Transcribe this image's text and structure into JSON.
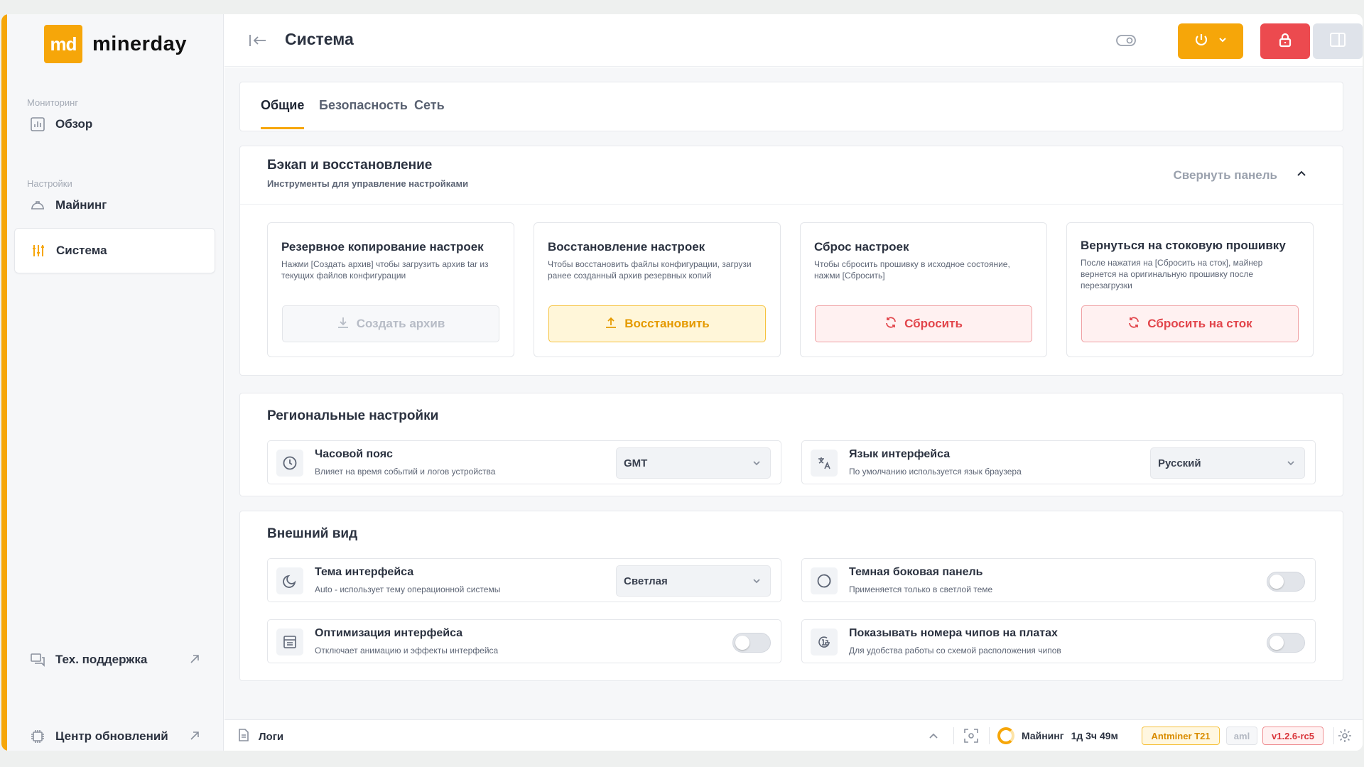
{
  "brand": {
    "mark": "md",
    "name": "minerday"
  },
  "sidebar": {
    "section_monitoring": "Мониторинг",
    "overview": "Обзор",
    "section_settings": "Настройки",
    "mining": "Майнинг",
    "system": "Система",
    "support": "Тех. поддержка",
    "updates": "Центр обновлений"
  },
  "header": {
    "title": "Система"
  },
  "tabs": [
    {
      "label": "Общие",
      "active": true
    },
    {
      "label": "Безопасность",
      "active": false
    },
    {
      "label": "Сеть",
      "active": false
    }
  ],
  "backup": {
    "title": "Бэкап и восстановление",
    "subtitle": "Инструменты для управление настройками",
    "collapse_label": "Свернуть панель",
    "cards": [
      {
        "title": "Резервное копирование настроек",
        "desc": "Нажми [Создать архив] чтобы загрузить архив tar из текущих файлов конфигурации",
        "button": "Создать архив",
        "state": "disabled"
      },
      {
        "title": "Восстановление настроек",
        "desc": "Чтобы восстановить файлы конфигурации, загрузи ранее созданный архив резервных копий",
        "button": "Восстановить",
        "state": "warning"
      },
      {
        "title": "Сброс настроек",
        "desc": "Чтобы сбросить прошивку в исходное состояние, нажми [Сбросить]",
        "button": "Сбросить",
        "state": "danger"
      },
      {
        "title": "Вернуться на стоковую прошивку",
        "desc": "После нажатия на [Сбросить на сток], майнер вернется на оригинальную прошивку после перезагрузки",
        "button": "Сбросить на сток",
        "state": "danger"
      }
    ]
  },
  "regional": {
    "title": "Региональные настройки",
    "timezone": {
      "title": "Часовой пояс",
      "desc": "Влияет на время событий и логов устройства",
      "value": "GMT"
    },
    "language": {
      "title": "Язык интерфейса",
      "desc": "По умолчанию используется язык браузера",
      "value": "Русский"
    }
  },
  "appearance": {
    "title": "Внешний вид",
    "theme": {
      "title": "Тема интерфейса",
      "desc": "Auto - использует тему операционной системы",
      "value": "Светлая"
    },
    "dark_sidebar": {
      "title": "Темная боковая панель",
      "desc": "Применяется только в светлой теме",
      "enabled": false
    },
    "optimization": {
      "title": "Оптимизация интерфейса",
      "desc": "Отключает анимацию и эффекты интерфейса",
      "enabled": false
    },
    "chip_numbers": {
      "title": "Показывать номера чипов на платах",
      "desc": "Для удобства работы со схемой расположения чипов",
      "enabled": false
    }
  },
  "footer": {
    "logs": "Логи",
    "mining_label": "Майнинг",
    "uptime": "1д 3ч 49м",
    "model": "Antminer T21",
    "aml": "aml",
    "version": "v1.2.6-rc5"
  },
  "colors": {
    "accent": "#f6a609",
    "danger": "#ec4a4f",
    "panel": "#dfe3ea"
  }
}
